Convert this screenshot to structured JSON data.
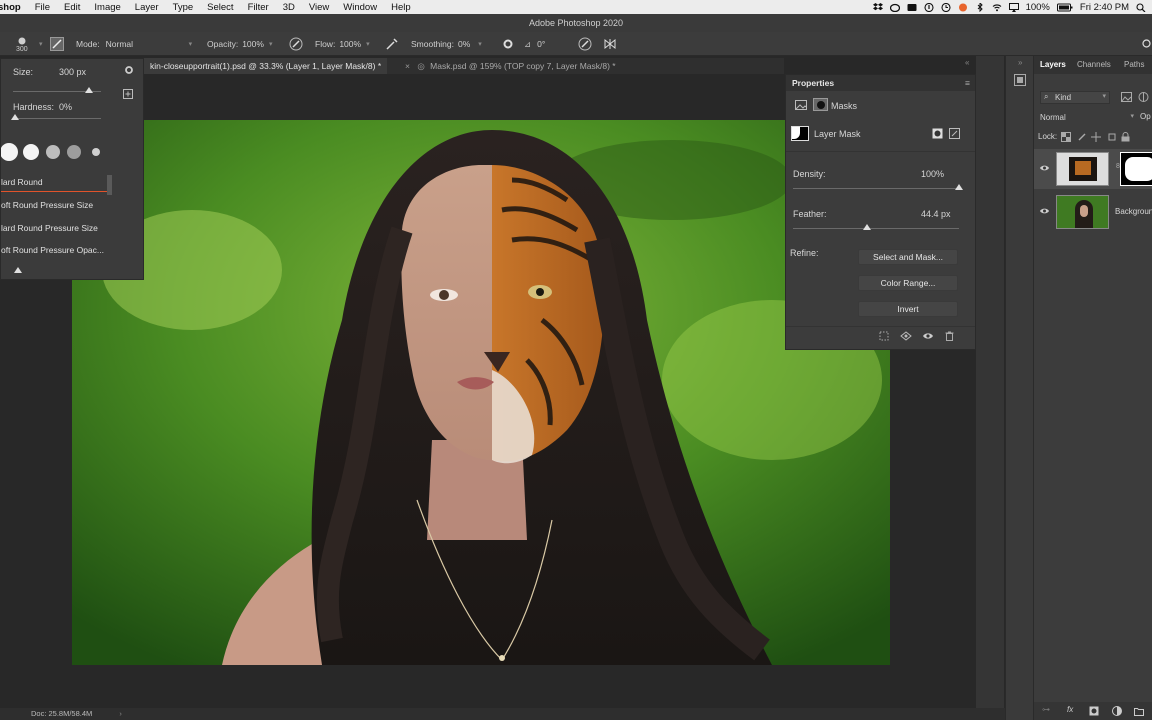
{
  "menubar": {
    "app_name": "shop",
    "items": [
      "File",
      "Edit",
      "Image",
      "Layer",
      "Type",
      "Select",
      "Filter",
      "3D",
      "View",
      "Window",
      "Help"
    ],
    "battery": "100%",
    "clock": "Fri 2:40 PM"
  },
  "window": {
    "title": "Adobe Photoshop 2020"
  },
  "options": {
    "brush_size": "300",
    "mode_label": "Mode:",
    "mode_value": "Normal",
    "opacity_label": "Opacity:",
    "opacity_value": "100%",
    "flow_label": "Flow:",
    "flow_value": "100%",
    "smoothing_label": "Smoothing:",
    "smoothing_value": "0%",
    "angle_value": "0°"
  },
  "tabs": [
    {
      "label": "kin-closeupportrait(1).psd @ 33.3% (Layer 1, Layer Mask/8) *",
      "active": true
    },
    {
      "label": "Mask.psd @ 159% (TOP copy 7, Layer Mask/8) *",
      "active": false
    }
  ],
  "brush_popup": {
    "size_label": "Size:",
    "size_value": "300 px",
    "size_level": 1.0,
    "hardness_label": "Hardness:",
    "hardness_value": "0%",
    "presets": [
      "lard Round",
      "oft Round Pressure Size",
      "lard Round Pressure Size",
      "oft Round Pressure Opac..."
    ]
  },
  "properties": {
    "title": "Properties",
    "section": "Masks",
    "layer_mask_label": "Layer Mask",
    "density_label": "Density:",
    "density_value": "100%",
    "density_level": 1.0,
    "feather_label": "Feather:",
    "feather_value": "44.4 px",
    "feather_level": 0.444,
    "refine_label": "Refine:",
    "select_and_mask": "Select and Mask...",
    "color_range": "Color Range...",
    "invert": "Invert"
  },
  "layers": {
    "tabs": [
      "Layers",
      "Channels",
      "Paths"
    ],
    "filter_kind": "Kind",
    "blend_mode": "Normal",
    "opacity_short": "Op",
    "lock_label": "Lock:",
    "rows": [
      {
        "name": ""
      },
      {
        "name": "Backgroun"
      }
    ]
  },
  "status": {
    "doc": "Doc: 25.8M/58.4M"
  },
  "colors": {
    "accent": "#e1532b",
    "panel": "#3c3c3c",
    "bg": "#282828"
  }
}
